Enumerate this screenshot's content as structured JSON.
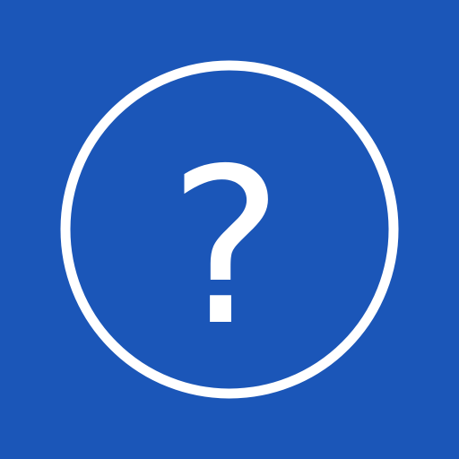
{
  "app": {
    "icon": "help-question-icon",
    "glyph": "?",
    "colors": {
      "background": "#1b56b8",
      "foreground": "#ffffff"
    }
  }
}
